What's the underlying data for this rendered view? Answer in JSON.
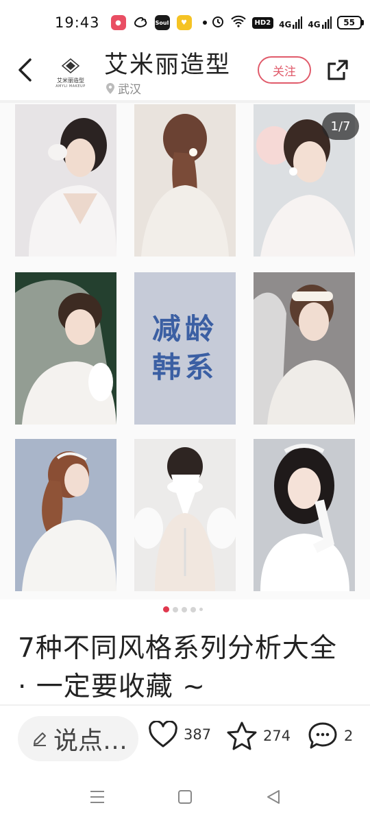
{
  "status_bar": {
    "time": "19:43",
    "network_badge": "HD2",
    "signal1": "4G",
    "signal2": "4G",
    "battery": "55"
  },
  "header": {
    "account_name": "艾米丽造型",
    "location": "武汉",
    "follow_label": "关注",
    "logo_text_cn": "艾米丽造型",
    "logo_text_en": "AMYLI MAKEUP"
  },
  "gallery": {
    "page_counter": "1/7",
    "text_tile_line1": "减龄",
    "text_tile_line2": "韩系",
    "current_page": 1,
    "total_pages": 5
  },
  "post": {
    "title": "7种不同风格系列分析大全 · 一定要收藏 ~"
  },
  "actions": {
    "comment_placeholder": "说点…",
    "likes": "387",
    "favorites": "274",
    "comments": "2"
  },
  "colors": {
    "accent": "#e05a6a",
    "pager_active": "#e0384e",
    "text_tile_bg": "#c6cbd8",
    "text_tile_fg": "#3b5fa3"
  }
}
